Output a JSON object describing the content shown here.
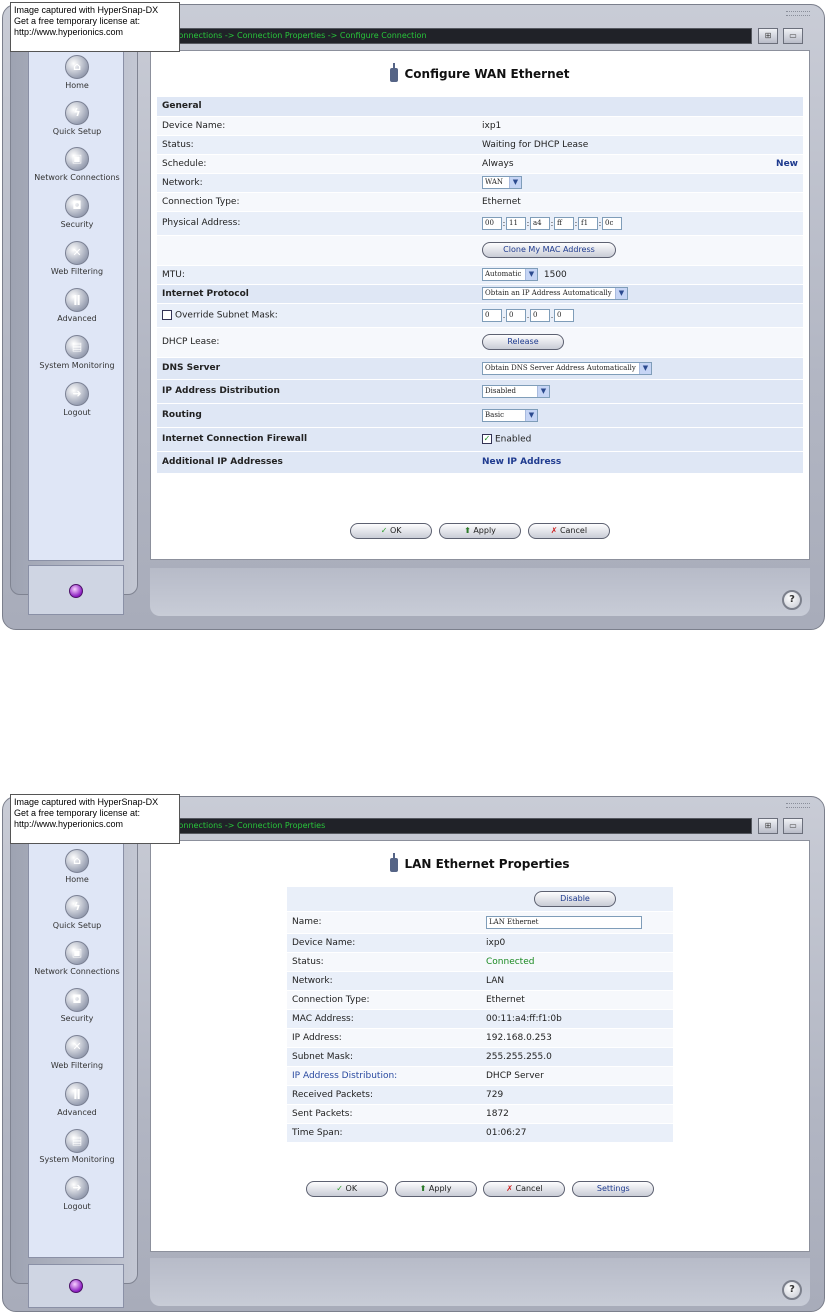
{
  "watermark": {
    "line1": "Image captured with HyperSnap-DX",
    "line2": "Get a free temporary license at:",
    "line3": "http://www.hyperionics.com"
  },
  "sidebar": {
    "items": [
      {
        "label": "Home",
        "icon": "home-icon"
      },
      {
        "label": "Quick Setup",
        "icon": "lightning-icon"
      },
      {
        "label": "Network Connections",
        "icon": "network-icon"
      },
      {
        "label": "Security",
        "icon": "lock-icon"
      },
      {
        "label": "Web Filtering",
        "icon": "filter-icon"
      },
      {
        "label": "Advanced",
        "icon": "advanced-icon"
      },
      {
        "label": "System Monitoring",
        "icon": "monitor-icon"
      },
      {
        "label": "Logout",
        "icon": "logout-icon"
      }
    ]
  },
  "screen1": {
    "breadcrumb": "work Connections -> Connection Properties -> Configure Connection",
    "title": "Configure WAN Ethernet",
    "general_header": "General",
    "device_name_label": "Device Name:",
    "device_name_value": "ixp1",
    "status_label": "Status:",
    "status_value": "Waiting for DHCP Lease",
    "schedule_label": "Schedule:",
    "schedule_value": "Always",
    "schedule_new_link": "New",
    "network_label": "Network:",
    "network_value": "WAN",
    "connection_type_label": "Connection Type:",
    "connection_type_value": "Ethernet",
    "physical_address_label": "Physical Address:",
    "mac_octets": [
      "00",
      "11",
      "a4",
      "ff",
      "f1",
      "0c"
    ],
    "clone_mac_button": "Clone My MAC Address",
    "mtu_label": "MTU:",
    "mtu_mode": "Automatic",
    "mtu_value": "1500",
    "internet_protocol_label": "Internet Protocol",
    "internet_protocol_value": "Obtain an IP Address Automatically",
    "override_subnet_label": "Override Subnet Mask:",
    "subnet_octets": [
      "0",
      "0",
      "0",
      "0"
    ],
    "dhcp_lease_label": "DHCP Lease:",
    "release_button": "Release",
    "dns_server_label": "DNS Server",
    "dns_server_value": "Obtain DNS Server Address Automatically",
    "ip_distribution_label": "IP Address Distribution",
    "ip_distribution_value": "Disabled",
    "routing_label": "Routing",
    "routing_value": "Basic",
    "firewall_label": "Internet Connection Firewall",
    "firewall_value": "Enabled",
    "additional_ip_label": "Additional IP Addresses",
    "new_ip_link": "New IP Address",
    "ok_button": "OK",
    "apply_button": "Apply",
    "cancel_button": "Cancel"
  },
  "screen2": {
    "breadcrumb": "work Connections -> Connection Properties",
    "title": "LAN Ethernet Properties",
    "disable_button": "Disable",
    "name_label": "Name:",
    "name_value": "LAN Ethernet",
    "rows": [
      {
        "label": "Device Name:",
        "value": "ixp0"
      },
      {
        "label": "Status:",
        "value": "Connected"
      },
      {
        "label": "Network:",
        "value": "LAN"
      },
      {
        "label": "Connection Type:",
        "value": "Ethernet"
      },
      {
        "label": "MAC Address:",
        "value": "00:11:a4:ff:f1:0b"
      },
      {
        "label": "IP Address:",
        "value": "192.168.0.253"
      },
      {
        "label": "Subnet Mask:",
        "value": "255.255.255.0"
      },
      {
        "label": "IP Address Distribution:",
        "value": "DHCP Server"
      },
      {
        "label": "Received Packets:",
        "value": "729"
      },
      {
        "label": "Sent Packets:",
        "value": "1872"
      },
      {
        "label": "Time Span:",
        "value": "01:06:27"
      }
    ],
    "ok_button": "OK",
    "apply_button": "Apply",
    "cancel_button": "Cancel",
    "settings_button": "Settings"
  },
  "colors": {
    "breadcrumb_text": "#28c53a",
    "link": "#1f3b8f",
    "status_connected": "#1b8a22"
  }
}
